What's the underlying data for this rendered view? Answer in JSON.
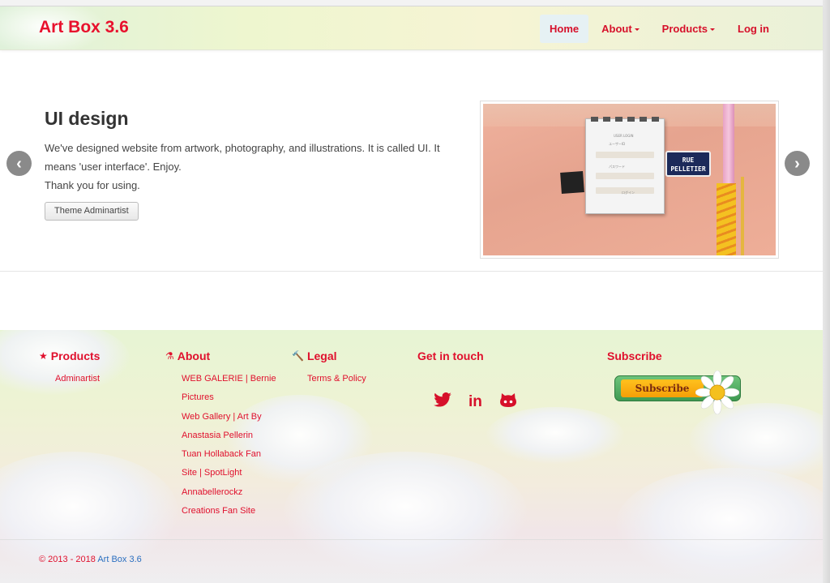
{
  "navbar": {
    "brand": "Art Box 3.6",
    "items": [
      {
        "label": "Home",
        "active": true,
        "dropdown": false
      },
      {
        "label": "About",
        "active": false,
        "dropdown": true
      },
      {
        "label": "Products",
        "active": false,
        "dropdown": true
      },
      {
        "label": "Log in",
        "active": false,
        "dropdown": false
      }
    ]
  },
  "carousel": {
    "title": "UI design",
    "text_lines": [
      "We've designed website from artwork, photography, and illustrations. It is called UI. It",
      "means 'user interface'. Enjoy.",
      "Thank you for using."
    ],
    "button_label": "Theme Adminartist",
    "prev_icon": "chevron-left-icon",
    "next_icon": "chevron-right-icon",
    "image": {
      "sign_line1": "RUE",
      "sign_line2": "PELLETIER",
      "login_card": {
        "title": "USER LOGIN",
        "user_label": "ユーザーID",
        "pass_label": "パスワード",
        "button": "ログイン"
      }
    }
  },
  "footer": {
    "products": {
      "heading": "Products",
      "icon": "star-icon",
      "links": [
        "Adminartist"
      ]
    },
    "about": {
      "heading": "About",
      "icon": "flask-icon",
      "links": [
        "WEB GALERIE | Bernie",
        "Pictures",
        "Web Gallery | Art By",
        "Anastasia Pellerin",
        "Tuan Hollaback Fan",
        "Site | SpotLight",
        "Annabellerockz",
        "Creations Fan Site"
      ]
    },
    "legal": {
      "heading": "Legal",
      "icon": "gavel-icon",
      "links": [
        "Terms & Policy"
      ]
    },
    "contact": {
      "heading": "Get in touch",
      "social": [
        "twitter-icon",
        "linkedin-icon",
        "github-icon"
      ]
    },
    "subscribe": {
      "heading": "Subscribe",
      "button_label": "Subscribe"
    },
    "copyright_text": "© 2013 - 2018 ",
    "copyright_link": "Art Box 3.6"
  },
  "colors": {
    "accent": "#e0102d",
    "link": "#2a6fc0"
  }
}
